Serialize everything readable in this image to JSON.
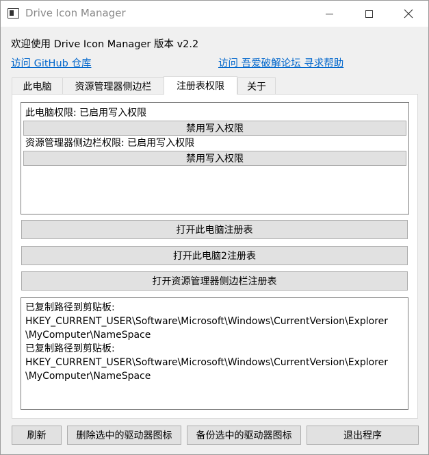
{
  "window": {
    "title": "Drive Icon Manager",
    "icon": "window-app-icon"
  },
  "header": {
    "welcome": "欢迎使用 Drive Icon Manager 版本 v2.2",
    "link_github": "访问 GitHub 仓库",
    "link_forum": "访问 吾爱破解论坛 寻求帮助"
  },
  "tabs": [
    {
      "label": "此电脑",
      "active": false
    },
    {
      "label": "资源管理器侧边栏",
      "active": false
    },
    {
      "label": "注册表权限",
      "active": true
    },
    {
      "label": "关于",
      "active": false
    }
  ],
  "permissions": {
    "this_pc_status": "此电脑权限: 已启用写入权限",
    "this_pc_button": "禁用写入权限",
    "sidebar_status": "资源管理器侧边栏权限: 已启用写入权限",
    "sidebar_button": "禁用写入权限"
  },
  "registry_buttons": {
    "open_this_pc": "打开此电脑注册表",
    "open_this_pc2": "打开此电脑2注册表",
    "open_sidebar": "打开资源管理器侧边栏注册表"
  },
  "log": {
    "lines": [
      "已复制路径到剪贴板:",
      "HKEY_CURRENT_USER\\Software\\Microsoft\\Windows\\CurrentVersion\\Explorer",
      "\\MyComputer\\NameSpace",
      "已复制路径到剪贴板:",
      "HKEY_CURRENT_USER\\Software\\Microsoft\\Windows\\CurrentVersion\\Explorer",
      "\\MyComputer\\NameSpace"
    ]
  },
  "footer": {
    "refresh": "刷新",
    "delete_selected": "删除选中的驱动器图标",
    "backup_selected": "备份选中的驱动器图标",
    "exit": "退出程序"
  },
  "colors": {
    "link": "#0066cc",
    "button_bg": "#e1e1e1",
    "window_bg": "#f0f0f0"
  }
}
